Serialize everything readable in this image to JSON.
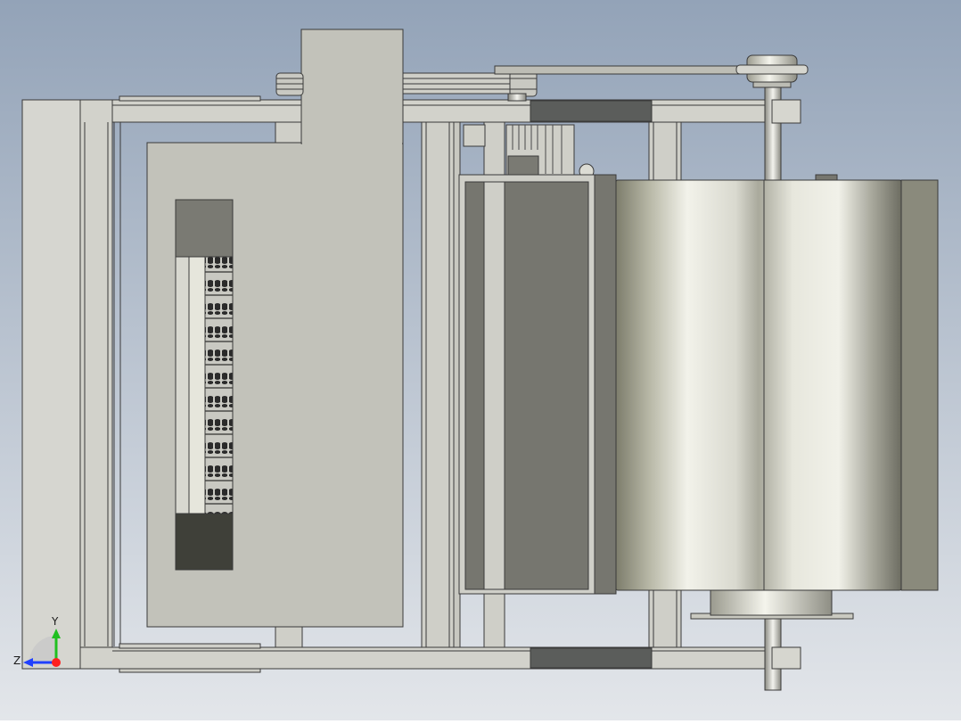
{
  "view": {
    "background_top": "#93a3b8",
    "background_bottom": "#e3e6ea"
  },
  "colors": {
    "frame_light": "#d4d4cf",
    "frame_mid": "#c2c2bb",
    "edge": "#3a3a3a",
    "dark_panel": "#5b5d5b",
    "darker_panel": "#3f4039",
    "cabinet_gray": "#76766f",
    "window_light": "#e6e6dc"
  },
  "axis_triad": {
    "x_label": "",
    "y_label": "Y",
    "z_label": "Z",
    "y_color": "#20c020",
    "z_color": "#2040ff",
    "origin_color": "#ff2020"
  }
}
